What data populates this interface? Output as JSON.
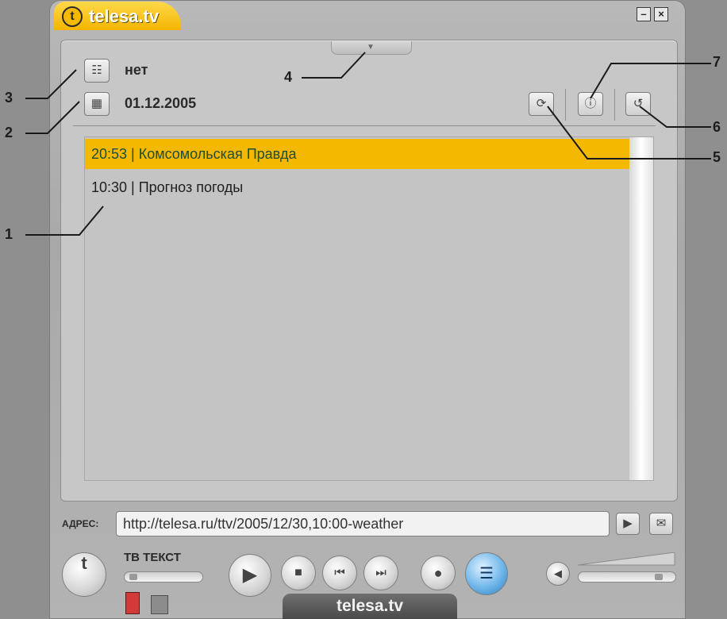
{
  "window": {
    "title": "telesa.tv",
    "logo_letter": "t",
    "minimize_icon": "minimize-icon",
    "close_icon": "close-icon"
  },
  "info": {
    "channel_value": "нет",
    "date_value": "01.12.2005"
  },
  "schedule": {
    "items": [
      {
        "time": "20:53",
        "title": "Комсомольская Правда",
        "text": "20:53 | Комсомольская Правда",
        "selected": true
      },
      {
        "time": "10:30",
        "title": "Прогноз погоды",
        "text": "10:30 | Прогноз погоды",
        "selected": false
      }
    ],
    "selected_color": "#f5b800"
  },
  "address": {
    "label": "АДРЕС:",
    "value": "http://telesa.ru/ttv/2005/12/30,10:00-weather"
  },
  "controls": {
    "tv_text_label": "ТВ ТЕКСТ",
    "bottom_title": "telesa.tv"
  },
  "annotations": [
    "1",
    "2",
    "3",
    "4",
    "5",
    "6",
    "7"
  ]
}
